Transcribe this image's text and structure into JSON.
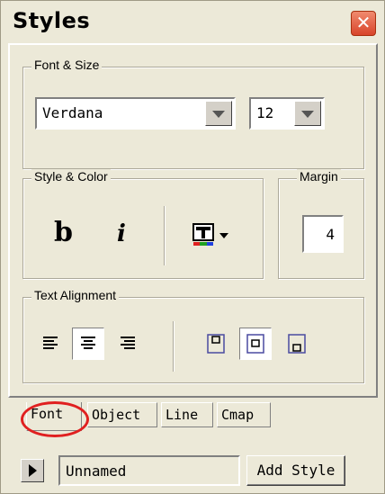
{
  "window": {
    "title": "Styles",
    "close_glyph": "✕"
  },
  "font_size_group": {
    "legend": "Font & Size",
    "font_name": "Verdana",
    "font_size": "12"
  },
  "style_color_group": {
    "legend": "Style & Color",
    "bold_glyph": "b",
    "italic_glyph": "i",
    "color_icon": "text-color-icon"
  },
  "margin_group": {
    "legend": "Margin",
    "value": "4"
  },
  "alignment_group": {
    "legend": "Text Alignment",
    "horizontal": [
      "align-left-icon",
      "align-center-icon",
      "align-right-icon"
    ],
    "vertical": [
      "valign-top-icon",
      "valign-middle-icon",
      "valign-bottom-icon"
    ],
    "selected_horizontal": "center",
    "selected_vertical": "middle"
  },
  "tabs": [
    {
      "label": "Font",
      "active": true
    },
    {
      "label": "Object",
      "active": false
    },
    {
      "label": "Line",
      "active": false
    },
    {
      "label": "Cmap",
      "active": false
    }
  ],
  "footer": {
    "style_name": "Unnamed",
    "add_style_label": "Add Style"
  },
  "colors": {
    "annotation_ring": "#e02020",
    "close_button": "#d8442a",
    "dialog_bg": "#ece9d8"
  }
}
